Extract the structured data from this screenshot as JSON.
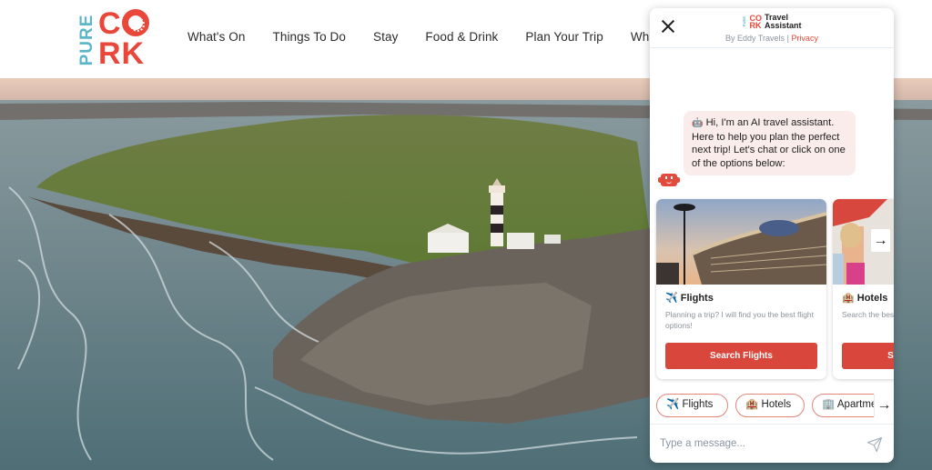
{
  "site": {
    "logo": {
      "pure": "PURE",
      "cork_top": "C",
      "cork_o": "O",
      "cork_bottom": "RK"
    },
    "nav": [
      {
        "label": "What's On"
      },
      {
        "label": "Things To Do"
      },
      {
        "label": "Stay"
      },
      {
        "label": "Food & Drink"
      },
      {
        "label": "Plan Your Trip"
      },
      {
        "label": "What's New"
      }
    ],
    "hero": {
      "alt": "Aerial view of Old Head of Kinsale lighthouse on a rocky headland with waves"
    }
  },
  "chat": {
    "header": {
      "logo_pure": "PURE",
      "logo_cork_top": "CO",
      "logo_cork_bottom": "RK",
      "title_line1": "Travel",
      "title_line2": "Assistant",
      "by": "By Eddy Travels",
      "separator": "|",
      "privacy": "Privacy"
    },
    "message": {
      "icon": "🤖",
      "text": "Hi, I'm an AI travel assistant. Here to help you plan the perfect next trip! Let's chat or click on one of the options below:"
    },
    "cards": [
      {
        "icon": "✈️",
        "title": "Flights",
        "description": "Planning a trip? I will find you the best flight options!",
        "cta": "Search Flights"
      },
      {
        "icon": "🏨",
        "title": "Hotels",
        "description": "Search the best hotels around the world!",
        "cta": "Search Hotels"
      }
    ],
    "quick_replies": [
      {
        "icon": "✈️",
        "label": "Flights"
      },
      {
        "icon": "🏨",
        "label": "Hotels"
      },
      {
        "icon": "🏢",
        "label": "Apartments"
      }
    ],
    "composer": {
      "placeholder": "Type a message..."
    },
    "arrows": {
      "next": "→"
    },
    "colors": {
      "accent": "#d9463b",
      "bubble": "#f9eceb",
      "chip_border": "#e2857b",
      "brand_teal": "#5bb6c7",
      "brand_red": "#e8473a"
    }
  }
}
